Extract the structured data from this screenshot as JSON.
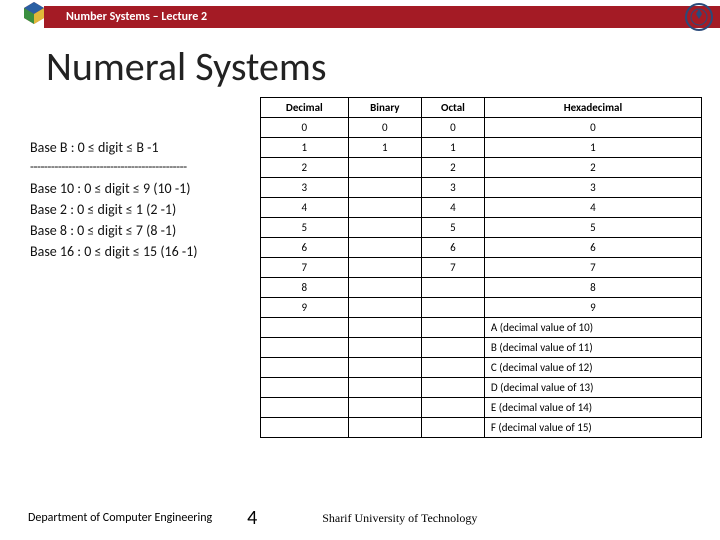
{
  "header": {
    "breadcrumb": "Number Systems – Lecture 2"
  },
  "title": "Numeral Systems",
  "left_text": {
    "line1": "Base  B  :  0 ≤ digit ≤ B -1",
    "sep": "---------------------------------------------",
    "line2": "Base 10 :  0 ≤ digit ≤ 9 (10 -1)",
    "line3": "Base 2   :  0 ≤ digit ≤ 1 (2 -1)",
    "line4": "Base 8   :  0 ≤ digit ≤ 7 (8 -1)",
    "line5": "Base 16 :  0 ≤ digit ≤ 15 (16 -1)"
  },
  "table": {
    "headers": [
      "Decimal",
      "Binary",
      "Octal",
      "Hexadecimal"
    ],
    "rows": [
      {
        "d": "0",
        "b": "0",
        "o": "0",
        "h": "0"
      },
      {
        "d": "1",
        "b": "1",
        "o": "1",
        "h": "1"
      },
      {
        "d": "2",
        "b": "",
        "o": "2",
        "h": "2"
      },
      {
        "d": "3",
        "b": "",
        "o": "3",
        "h": "3"
      },
      {
        "d": "4",
        "b": "",
        "o": "4",
        "h": "4"
      },
      {
        "d": "5",
        "b": "",
        "o": "5",
        "h": "5"
      },
      {
        "d": "6",
        "b": "",
        "o": "6",
        "h": "6"
      },
      {
        "d": "7",
        "b": "",
        "o": "7",
        "h": "7"
      },
      {
        "d": "8",
        "b": "",
        "o": "",
        "h": "8"
      },
      {
        "d": "9",
        "b": "",
        "o": "",
        "h": "9"
      },
      {
        "d": "",
        "b": "",
        "o": "",
        "h": "A   (decimal value of 10)"
      },
      {
        "d": "",
        "b": "",
        "o": "",
        "h": "B   (decimal value of 11)"
      },
      {
        "d": "",
        "b": "",
        "o": "",
        "h": "C   (decimal value of 12)"
      },
      {
        "d": "",
        "b": "",
        "o": "",
        "h": "D   (decimal value of 13)"
      },
      {
        "d": "",
        "b": "",
        "o": "",
        "h": "E   (decimal value of 14)"
      },
      {
        "d": "",
        "b": "",
        "o": "",
        "h": "F   (decimal value of 15)"
      }
    ]
  },
  "footer": {
    "dept": "Department of Computer Engineering",
    "slide_num": "4",
    "uni": "Sharif University of Technology"
  }
}
